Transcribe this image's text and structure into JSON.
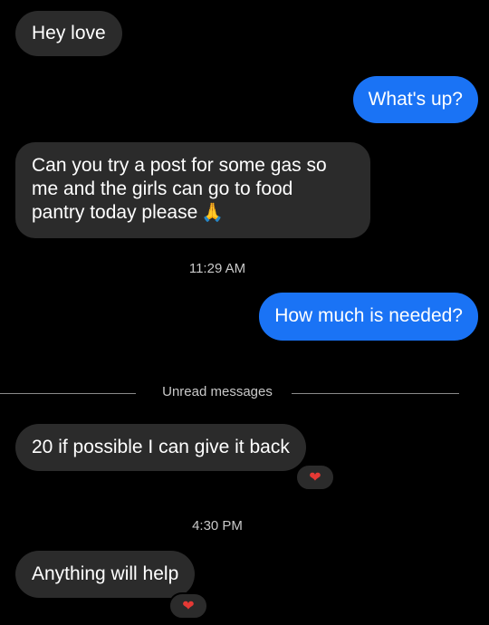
{
  "messages": [
    {
      "text": "Hey love"
    },
    {
      "text": "What's up?"
    },
    {
      "line1": "Can you try a post for some gas so",
      "line2": "me and the girls can go to food",
      "line3": "pantry today please",
      "emoji": "🙏"
    },
    {
      "text": "How much is needed?"
    },
    {
      "text": "20 if possible I can give it back",
      "reaction": "❤"
    },
    {
      "text": "Anything will help",
      "reaction": "❤"
    }
  ],
  "timestamps": [
    "11:29 AM",
    "4:30 PM"
  ],
  "divider": {
    "label": "Unread messages"
  },
  "icons": {
    "reaction": "red-heart-icon",
    "emoji": "folded-hands-icon"
  },
  "colors": {
    "background": "#000000",
    "received_bubble": "#2b2b2b",
    "sent_bubble": "#1a73f5",
    "heart": "#e53935"
  }
}
